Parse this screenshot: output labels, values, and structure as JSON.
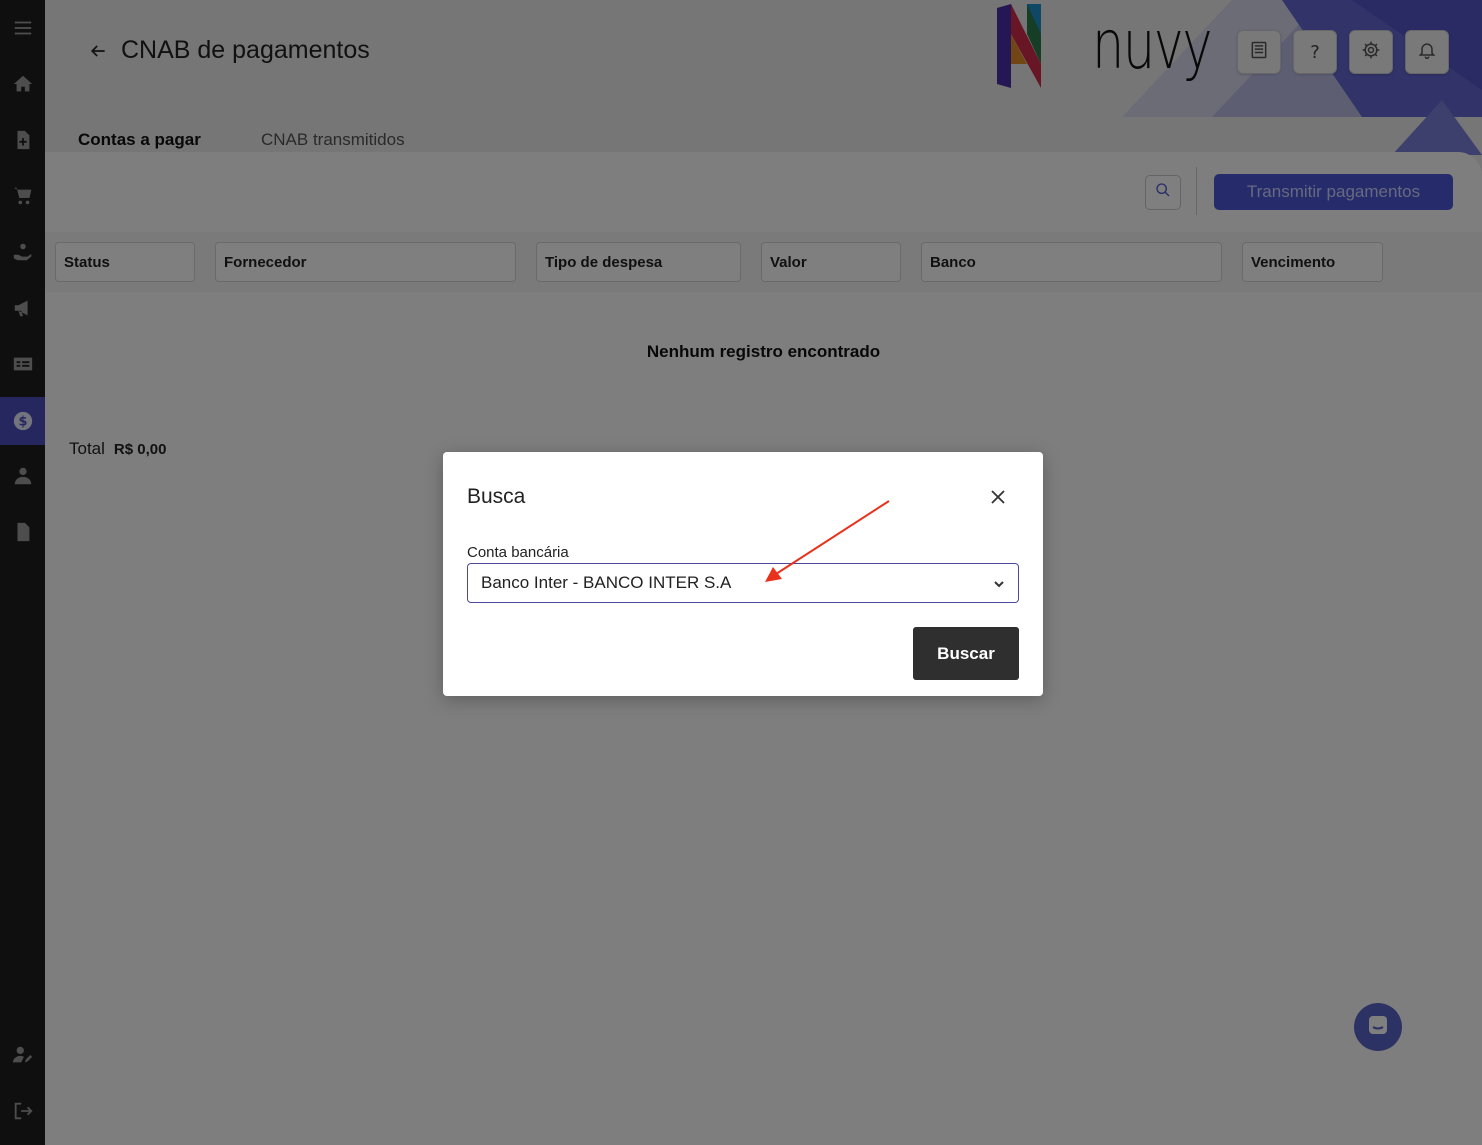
{
  "page": {
    "title": "CNAB de pagamentos"
  },
  "brand": {
    "logo_text": "nuvy",
    "accent": "#4d57d6"
  },
  "sidebar": {
    "items": [
      {
        "name": "menu-icon"
      },
      {
        "name": "home-icon"
      },
      {
        "name": "add-document-icon"
      },
      {
        "name": "cart-icon"
      },
      {
        "name": "hand-money-icon"
      },
      {
        "name": "megaphone-icon"
      },
      {
        "name": "billing-icon"
      },
      {
        "name": "dollar-circle-icon",
        "active": true
      },
      {
        "name": "user-icon"
      },
      {
        "name": "document-icon"
      },
      {
        "name": "user-edit-icon"
      },
      {
        "name": "logout-icon"
      }
    ]
  },
  "header_buttons": [
    {
      "name": "news-icon"
    },
    {
      "name": "help-icon",
      "label": "?"
    },
    {
      "name": "gear-icon"
    },
    {
      "name": "bell-icon"
    }
  ],
  "tabs": [
    {
      "label": "Contas a pagar",
      "active": true
    },
    {
      "label": "CNAB transmitidos",
      "active": false
    }
  ],
  "toolbar": {
    "transmit_label": "Transmitir pagamentos"
  },
  "table": {
    "columns": [
      "Status",
      "Fornecedor",
      "Tipo de despesa",
      "Valor",
      "Banco",
      "Vencimento"
    ],
    "empty_message": "Nenhum registro encontrado"
  },
  "summary": {
    "total_label": "Total",
    "total_value": "R$ 0,00"
  },
  "modal": {
    "title": "Busca",
    "field_label": "Conta bancária",
    "selected_value": "Banco Inter - BANCO INTER S.A",
    "submit_label": "Buscar"
  }
}
